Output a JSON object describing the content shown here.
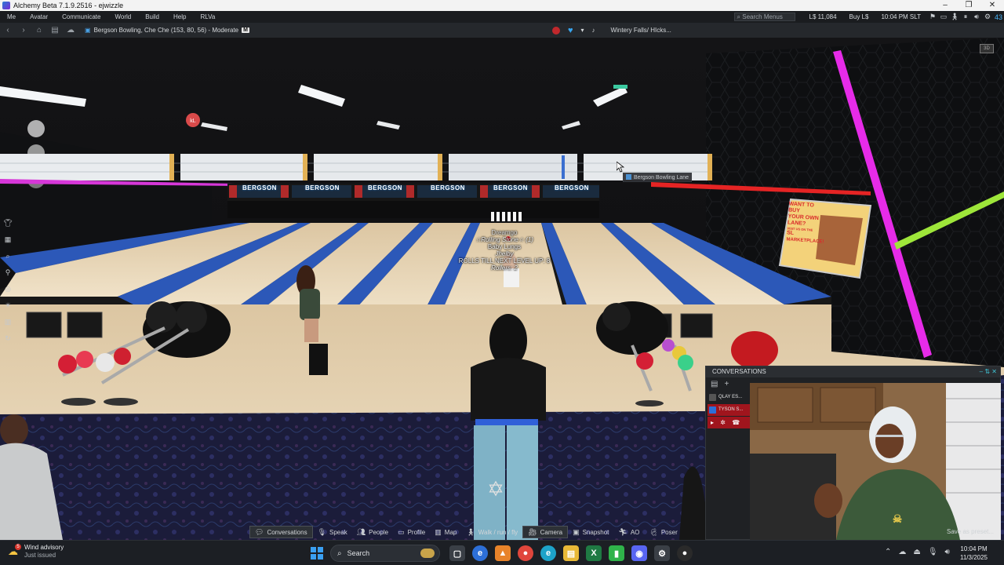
{
  "window": {
    "title": "Alchemy Beta 7.1.9.2516 - ejwizzle",
    "controls": [
      "minimize-icon",
      "restore-icon",
      "close-icon"
    ]
  },
  "menubar": {
    "items": [
      "Me",
      "Avatar",
      "Communicate",
      "World",
      "Build",
      "Help",
      "RLVa"
    ],
    "search_placeholder": "Search Menus",
    "balance": "L$ 11,084",
    "buy": "Buy L$",
    "time": "10:04 PM SLT"
  },
  "navbar": {
    "location": "Bergson Bowling, Che Che (153, 80, 56) - Moderate",
    "rating_badge": "M",
    "media_title": "Wintery Falls/ HIcks..."
  },
  "scene": {
    "hover_tooltip": "Bergson Bowling Lane",
    "minimap_label": "3D",
    "lane_sign": "BERGSON",
    "sign_lines": [
      "WANT TO BUY",
      "YOUR OWN",
      "LANE?",
      "VISIT US ON THE",
      "SL",
      "MARKETPLACE!"
    ],
    "bowler_name": "Dreamgo",
    "bowler_tag_lines": [
      "☆Rolling Stone☆ (1)",
      "Baby Lungs",
      "Jhelby",
      "ROLLS TILL NEXT LEVEL UP: 8",
      "Rollers: 2"
    ]
  },
  "conversations": {
    "title": "CONVERSATIONS",
    "rows": [
      {
        "name": "QLAY ES..."
      },
      {
        "name": "TYSON S..."
      }
    ]
  },
  "bottom_toolbar": {
    "buttons": [
      {
        "label": "Conversations",
        "icon": "chat-bubble-icon",
        "active": true
      },
      {
        "label": "Speak",
        "icon": "microphone-icon",
        "active": false
      },
      {
        "label": "People",
        "icon": "people-icon",
        "active": false
      },
      {
        "label": "Profile",
        "icon": "profile-card-icon",
        "active": false
      },
      {
        "label": "Map",
        "icon": "map-icon",
        "active": false
      },
      {
        "label": "Walk / run / fly",
        "icon": "walk-icon",
        "active": false
      },
      {
        "label": "Camera",
        "icon": "camera-icon",
        "active": true
      },
      {
        "label": "Snapshot",
        "icon": "snapshot-icon",
        "active": false
      },
      {
        "label": "AO",
        "icon": "ao-icon",
        "active": false
      },
      {
        "label": "Poser",
        "icon": "poser-icon",
        "active": false
      }
    ],
    "save_as_preset": "Save as preset..."
  },
  "taskbar": {
    "weather_title": "Wind advisory",
    "weather_sub": "Just issued",
    "weather_badge": "5",
    "search_placeholder": "Search",
    "clock_time": "10:04 PM",
    "clock_date": "11/3/2025"
  },
  "colors": {
    "neon_magenta": "#e62be8",
    "neon_green": "#9ee63a",
    "neon_red": "#e52424",
    "lane_wood": "#e8d6b8",
    "gutter_blue": "#2c58b8",
    "carpet": "#1e1f3e",
    "conv_highlight": "#a0151d",
    "menubar_bg": "#1a1c1f"
  }
}
